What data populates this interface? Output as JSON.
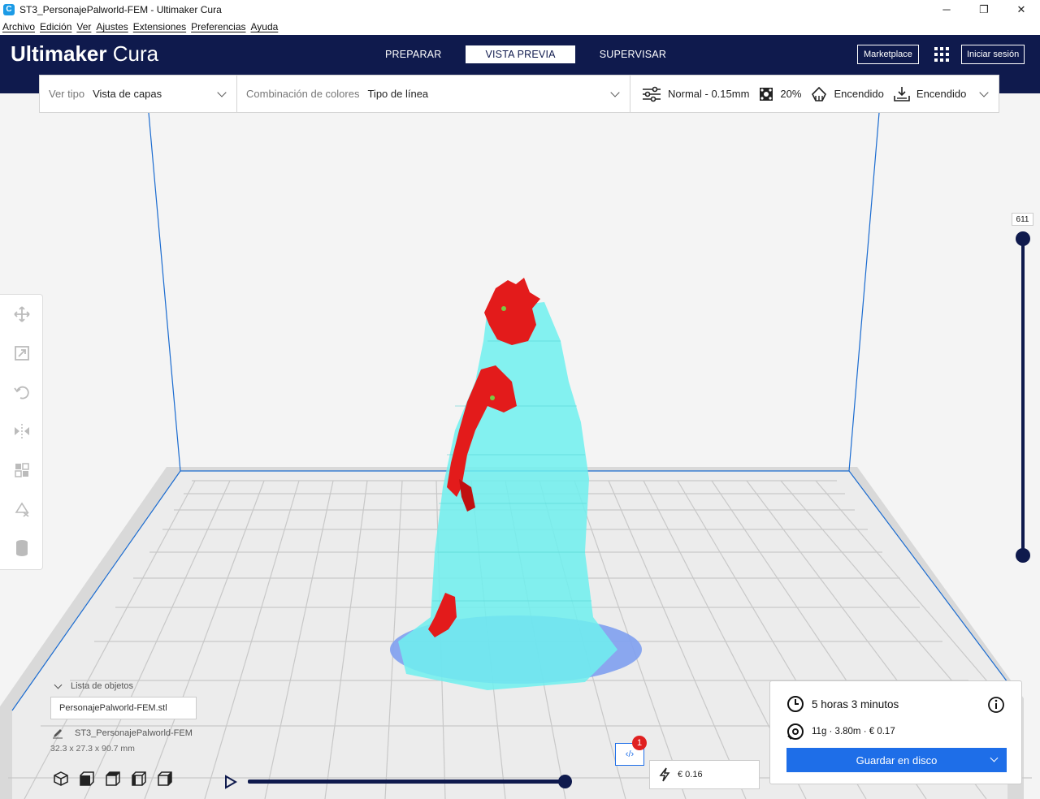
{
  "window": {
    "title": "ST3_PersonajePalworld-FEM - Ultimaker Cura",
    "minimize": "─",
    "maximize": "❐",
    "close": "✕"
  },
  "menu": [
    "Archivo",
    "Edición",
    "Ver",
    "Ajustes",
    "Extensiones",
    "Preferencias",
    "Ayuda"
  ],
  "header": {
    "brand_bold": "Ultimaker",
    "brand_light": "Cura",
    "tabs": [
      "PREPARAR",
      "VISTA PREVIA",
      "SUPERVISAR"
    ],
    "active_tab": "VISTA PREVIA",
    "marketplace": "Marketplace",
    "login": "Iniciar sesión"
  },
  "toolbar": {
    "view_type_label": "Ver tipo",
    "view_type_value": "Vista de capas",
    "color_scheme_label": "Combinación de colores",
    "color_scheme_value": "Tipo de línea",
    "profile": "Normal - 0.15mm",
    "infill": "20%",
    "support": "Encendido",
    "adhesion": "Encendido"
  },
  "layer_slider": {
    "current_layer": "611",
    "max_position": 1.0,
    "min_position": 0.0
  },
  "objects": {
    "title": "Lista de objetos",
    "file": "PersonajePalworld-FEM.stl",
    "job_name": "ST3_PersonajePalworld-FEM",
    "dimensions": "32.3 x 27.3 x 90.7 mm"
  },
  "simulation": {
    "progress": 1.0
  },
  "notifications": {
    "count": "1",
    "code_label": "‹/›"
  },
  "cost_estimate": "€ 0.16",
  "print_info": {
    "time": "5 horas 3 minutos",
    "material": "11g · 3.80m · € 0.17",
    "save_button": "Guardar en disco"
  },
  "colors": {
    "header": "#0f1a4d",
    "accent": "#1e6ee8",
    "model_shell": "#e31b1b",
    "model_support": "#6ff0ee",
    "build_plate": "#e6e6e6",
    "build_volume_lines": "#1a6bd0"
  }
}
